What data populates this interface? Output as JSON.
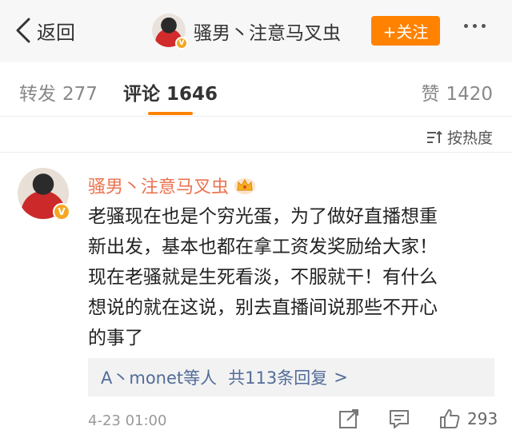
{
  "header": {
    "back_label": "返回",
    "title": "骚男丶注意马叉虫",
    "follow_label": "+关注"
  },
  "tabs": [
    {
      "label": "转发",
      "count": "277"
    },
    {
      "label": "评论",
      "count": "1646",
      "active": true
    },
    {
      "label": "赞",
      "count": "1420"
    }
  ],
  "sort": {
    "label": "按热度"
  },
  "comment": {
    "author": "骚男丶注意马叉虫",
    "lines": [
      "老骚现在也是个穷光蛋，为了做好直播想重",
      "新出发，基本也都在拿工资发奖励给大家！",
      "现在老骚就是生死看淡，不服就干！有什么",
      "想说的就在这说，别去直播间说那些不开心",
      "的事了"
    ],
    "reply_preview": {
      "names": "A丶monet等人",
      "summary": "共113条回复",
      "chevron": ">"
    },
    "time": "4-23 01:00",
    "like_count": "293"
  },
  "colors": {
    "accent": "#ff8200",
    "username": "#eb7350",
    "link": "#526c99",
    "verified": "#f5a623"
  },
  "icons": [
    "back-chevron-icon",
    "verified-icon",
    "more-icon",
    "sort-icon",
    "crown-icon",
    "repost-icon",
    "comment-icon",
    "like-icon"
  ]
}
